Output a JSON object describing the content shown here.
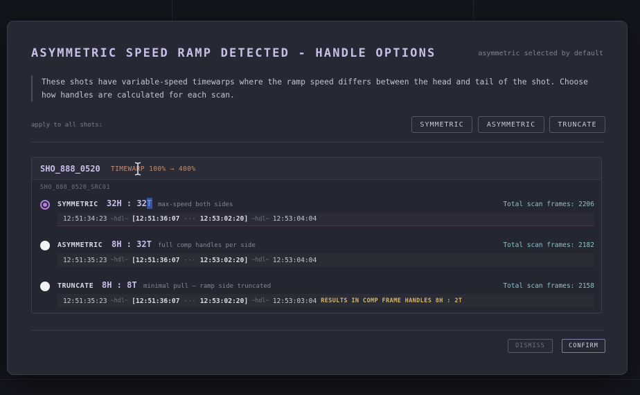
{
  "modal": {
    "title": "ASYMMETRIC SPEED RAMP DETECTED - HANDLE OPTIONS",
    "hint": "asymmetric selected by default",
    "description": "These shots have variable-speed timewarps where the ramp speed differs between the head and tail of the shot. Choose how handles are calculated for each scan.",
    "apply_label": "apply to all shots:",
    "apply_buttons": [
      "SYMMETRIC",
      "ASYMMETRIC",
      "TRUNCATE"
    ],
    "dismiss_label": "DISMISS",
    "confirm_label": "CONFIRM"
  },
  "shot": {
    "name": "SHO_888_0520",
    "timewarp": "TIMEWARP 100% → 400%",
    "scan_id": "SHO_888_0520_SRC01",
    "options": [
      {
        "label": "SYMMETRIC",
        "ratio": "32H : 32T",
        "note": "max-speed both sides",
        "total": "Total scan frames: 2206",
        "selected": true,
        "tc_start": "12:51:34:23",
        "hdl": "~hdl~",
        "tc_in": "[12:51:36:07",
        "dots": "···",
        "tc_out": "12:53:02:20]",
        "tc_end": "12:53:04:04",
        "warning": ""
      },
      {
        "label": "ASYMMETRIC",
        "ratio": "8H : 32T",
        "note": "full comp handles per side",
        "total": "Total scan frames: 2182",
        "selected": false,
        "tc_start": "12:51:35:23",
        "hdl": "~hdl~",
        "tc_in": "[12:51:36:07",
        "dots": "···",
        "tc_out": "12:53:02:20]",
        "tc_end": "12:53:04:04",
        "warning": ""
      },
      {
        "label": "TRUNCATE",
        "ratio": "8H : 8T",
        "note": "minimal pull — ramp side truncated",
        "total": "Total scan frames: 2158",
        "selected": false,
        "tc_start": "12:51:35:23",
        "hdl": "~hdl~",
        "tc_in": "[12:51:36:07",
        "dots": "···",
        "tc_out": "12:53:02:20]",
        "tc_end": "12:53:03:04",
        "warning": "RESULTS IN COMP FRAME HANDLES 8H : 2T"
      }
    ]
  },
  "colors": {
    "accent_purple": "#b27fe0",
    "timewarp_orange": "#c88b6c",
    "total_teal": "#8ec1c5",
    "warning_yellow": "#d4b46a"
  }
}
